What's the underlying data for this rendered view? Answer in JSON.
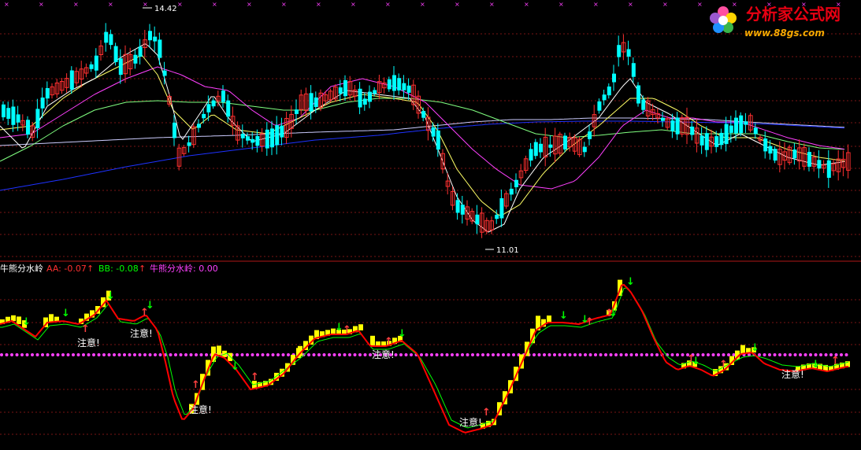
{
  "colors": {
    "background": "#000000",
    "grid": "#7a1414",
    "divider": "#b01818",
    "candle_up": "#ff3030",
    "candle_down": "#00ffff",
    "ma_white": "#ffffff",
    "ma_yellow": "#ffff66",
    "ma_magenta": "#ff40ff",
    "ma_green": "#80ff80",
    "ma_blue": "#1e32ff",
    "ma_lavender": "#ccccff",
    "aa_red": "#ff0000",
    "bb_green": "#00ff00",
    "threshold": "#ff40ff",
    "bar_yellow": "#ffff00",
    "arrow_up": "#ff4040",
    "arrow_down": "#00ff00"
  },
  "logo": {
    "name": "分析家公式网",
    "url": "www.88gs.com",
    "icon": "flower-logo-icon"
  },
  "price_panel": {
    "high_label": "14.42",
    "low_label": "11.01"
  },
  "indicator_panel": {
    "title": "牛熊分水岭",
    "aa_label": "AA: -0.07",
    "bb_label": "BB: -0.08",
    "line_label": "牛熊分水岭: 0.00",
    "note_text": "注意!"
  },
  "chart_data": [
    {
      "type": "candlestick",
      "price_high": 14.42,
      "price_low": 11.01,
      "moving_averages": [
        "white",
        "yellow",
        "magenta",
        "green",
        "lavender",
        "blue"
      ]
    },
    {
      "type": "line",
      "title": "牛熊分水岭",
      "series": [
        {
          "name": "AA",
          "last": -0.07
        },
        {
          "name": "BB",
          "last": -0.08
        },
        {
          "name": "牛熊分水岭",
          "last": 0.0
        }
      ]
    }
  ]
}
